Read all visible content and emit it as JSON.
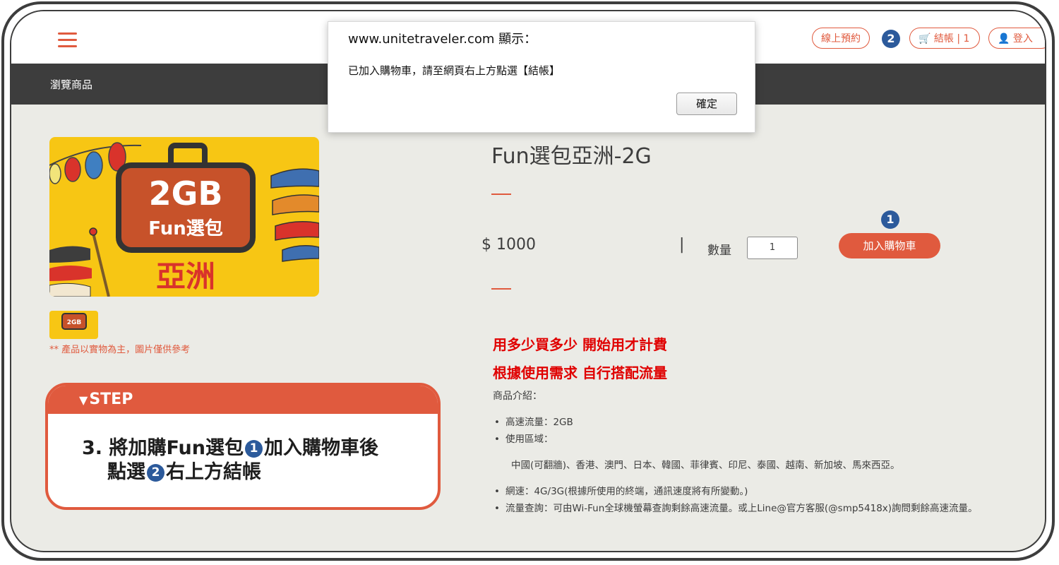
{
  "dialog": {
    "title": "www.unitetraveler.com 顯示：",
    "message": "已加入購物車，請至網頁右上方點選【結帳】",
    "ok_label": "確定"
  },
  "header": {
    "reserve_label": "線上預約",
    "checkout_label": "結帳 | 1",
    "login_label": "登入",
    "badge_2": "2"
  },
  "navbar": {
    "breadcrumb": "瀏覽商品"
  },
  "product": {
    "image_text_top": "2GB",
    "image_text_mid": "Fun選包",
    "image_text_bottom": "亞洲",
    "thumb_text": "2GB",
    "note": "** 產品以實物為主，圖片僅供參考",
    "title": "Fun選包亞洲-2G",
    "price": "$ 1000",
    "separator": "|",
    "qty_label": "數量",
    "qty_value": "1",
    "add_to_cart": "加入購物車",
    "badge_1": "1",
    "promo_1": "用多少買多少 開始用才計費",
    "promo_2": "根據使用需求 自行搭配流量",
    "intro_label": "商品介紹：",
    "spec_1": "高速流量：2GB",
    "spec_2": "使用區域：",
    "regions": "中國(可翻牆)、香港、澳門、日本、韓國、菲律賓、印尼、泰國、越南、新加坡、馬來西亞。",
    "spec_3": "網速：4G/3G(根據所使用的終端，通訊速度將有所變動。)",
    "spec_4": "流量查詢：可由Wi-Fun全球機螢幕查詢剩餘高速流量。或上Line@官方客服(@smp5418x)詢問剩餘高速流量。"
  },
  "step": {
    "heading": "STEP",
    "line1_a": "3. 將加購Fun選包",
    "circle_1": "1",
    "line1_b": "加入購物車後",
    "line2_a": "點選",
    "circle_2": "2",
    "line2_b": "右上方結帳"
  },
  "colors": {
    "accent": "#e05a3e",
    "dark_bar": "#3d3d3d",
    "badge": "#2c5a9b",
    "promo": "#e00000"
  }
}
